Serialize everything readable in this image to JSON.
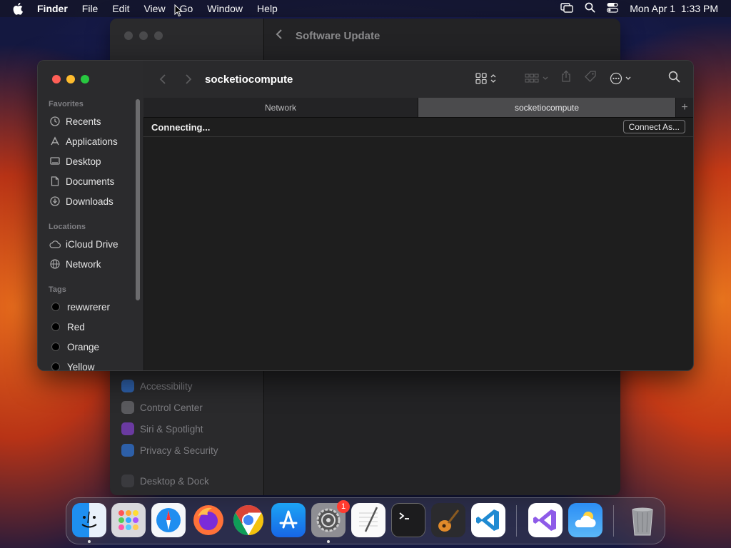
{
  "menubar": {
    "app_name": "Finder",
    "items": [
      "File",
      "Edit",
      "View",
      "Go",
      "Window",
      "Help"
    ],
    "datetime": "Mon Apr 1  1:33 PM"
  },
  "background_window": {
    "title": "Software Update",
    "items": [
      "Accessibility",
      "Control Center",
      "Siri & Spotlight",
      "Privacy & Security",
      "Desktop & Dock"
    ]
  },
  "finder": {
    "title": "socketiocompute",
    "sidebar": {
      "favorites_header": "Favorites",
      "favorites": [
        "Recents",
        "Applications",
        "Desktop",
        "Documents",
        "Downloads"
      ],
      "locations_header": "Locations",
      "locations": [
        "iCloud Drive",
        "Network"
      ],
      "tags_header": "Tags",
      "tags": [
        "rewwrerer",
        "Red",
        "Orange",
        "Yellow"
      ]
    },
    "tabs": [
      "Network",
      "socketiocompute"
    ],
    "tab_add": "+",
    "status": "Connecting...",
    "connect_button": "Connect As..."
  },
  "dock": {
    "apps": [
      "finder-icon",
      "launchpad-icon",
      "safari-icon",
      "firefox-icon",
      "chrome-icon",
      "app-store-icon",
      "system-settings-icon",
      "textedit-icon",
      "terminal-icon",
      "garageband-icon",
      "vscode-icon",
      "visual-studio-icon",
      "weather-icon",
      "trash-icon"
    ],
    "settings_badge": "1"
  }
}
